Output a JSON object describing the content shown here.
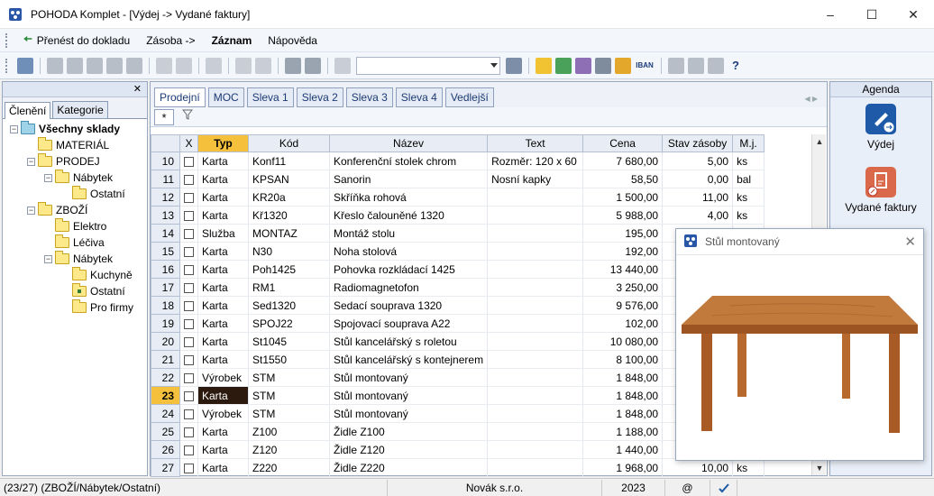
{
  "window": {
    "title": "POHODA Komplet - [Výdej -> Vydané faktury]"
  },
  "menu": [
    {
      "label": "Přenést do dokladu",
      "bold": false
    },
    {
      "label": "Zásoba ->",
      "bold": false
    },
    {
      "label": "Záznam",
      "bold": true
    },
    {
      "label": "Nápověda",
      "bold": false
    }
  ],
  "toolbar": {
    "iban_label": "IBAN",
    "search_value": ""
  },
  "left": {
    "tabs": [
      "Členění",
      "Kategorie"
    ],
    "tree": [
      {
        "label": "Všechny sklady",
        "level": 0,
        "bold": true,
        "expander": "−",
        "icon": "db"
      },
      {
        "label": "MATERIÁL",
        "level": 1,
        "bold": false,
        "expander": "",
        "icon": "folder"
      },
      {
        "label": "PRODEJ",
        "level": 1,
        "bold": false,
        "expander": "−",
        "icon": "folder"
      },
      {
        "label": "Nábytek",
        "level": 2,
        "bold": false,
        "expander": "−",
        "icon": "folder"
      },
      {
        "label": "Ostatní",
        "level": 3,
        "bold": false,
        "expander": "",
        "icon": "folder"
      },
      {
        "label": "ZBOŽÍ",
        "level": 1,
        "bold": false,
        "expander": "−",
        "icon": "folder"
      },
      {
        "label": "Elektro",
        "level": 2,
        "bold": false,
        "expander": "",
        "icon": "folder"
      },
      {
        "label": "Léčiva",
        "level": 2,
        "bold": false,
        "expander": "",
        "icon": "folder"
      },
      {
        "label": "Nábytek",
        "level": 2,
        "bold": false,
        "expander": "−",
        "icon": "folder"
      },
      {
        "label": "Kuchyně",
        "level": 3,
        "bold": false,
        "expander": "",
        "icon": "folder"
      },
      {
        "label": "Ostatní",
        "level": 3,
        "bold": false,
        "expander": "",
        "icon": "mark"
      },
      {
        "label": "Pro firmy",
        "level": 3,
        "bold": false,
        "expander": "",
        "icon": "folder"
      }
    ]
  },
  "tabs": [
    "Prodejní",
    "MOC",
    "Sleva 1",
    "Sleva 2",
    "Sleva 3",
    "Sleva 4",
    "Vedlejší"
  ],
  "filter_star": "*",
  "table": {
    "columns": [
      "",
      "X",
      "Typ",
      "Kód",
      "Název",
      "Text",
      "Cena",
      "Stav zásoby",
      "M.j."
    ],
    "rows": [
      [
        "10",
        "Karta",
        "Konf11",
        "Konferenční stolek chrom",
        "Rozměr: 120 x 60",
        "7 680,00",
        "5,00",
        "ks"
      ],
      [
        "11",
        "Karta",
        "KPSAN",
        "Sanorin",
        "Nosní kapky",
        "58,50",
        "0,00",
        "bal"
      ],
      [
        "12",
        "Karta",
        "KR20a",
        "Skříňka rohová",
        "",
        "1 500,00",
        "11,00",
        "ks"
      ],
      [
        "13",
        "Karta",
        "Kř1320",
        "Křeslo čalouněné 1320",
        "",
        "5 988,00",
        "4,00",
        "ks"
      ],
      [
        "14",
        "Služba",
        "MONTAZ",
        "Montáž stolu",
        "",
        "195,00",
        "",
        ""
      ],
      [
        "15",
        "Karta",
        "N30",
        "Noha stolová",
        "",
        "192,00",
        "",
        ""
      ],
      [
        "16",
        "Karta",
        "Poh1425",
        "Pohovka rozkládací 1425",
        "",
        "13 440,00",
        "",
        ""
      ],
      [
        "17",
        "Karta",
        "RM1",
        "Radiomagnetofon",
        "",
        "3 250,00",
        "",
        ""
      ],
      [
        "18",
        "Karta",
        "Sed1320",
        "Sedací souprava 1320",
        "",
        "9 576,00",
        "",
        ""
      ],
      [
        "19",
        "Karta",
        "SPOJ22",
        "Spojovací souprava A22",
        "",
        "102,00",
        "",
        ""
      ],
      [
        "20",
        "Karta",
        "St1045",
        "Stůl kancelářský s roletou",
        "",
        "10 080,00",
        "",
        ""
      ],
      [
        "21",
        "Karta",
        "St1550",
        "Stůl kancelářský s kontejnerem",
        "",
        "8 100,00",
        "",
        ""
      ],
      [
        "22",
        "Výrobek",
        "STM",
        "Stůl montovaný",
        "",
        "1 848,00",
        "",
        ""
      ],
      [
        "23",
        "Karta",
        "STM",
        "Stůl montovaný",
        "",
        "1 848,00",
        "",
        ""
      ],
      [
        "24",
        "Výrobek",
        "STM",
        "Stůl montovaný",
        "",
        "1 848,00",
        "",
        ""
      ],
      [
        "25",
        "Karta",
        "Z100",
        "Židle Z100",
        "",
        "1 188,00",
        "",
        ""
      ],
      [
        "26",
        "Karta",
        "Z120",
        "Židle Z120",
        "",
        "1 440,00",
        "",
        ""
      ],
      [
        "27",
        "Karta",
        "Z220",
        "Židle Z220",
        "",
        "1 968,00",
        "10,00",
        "ks"
      ]
    ],
    "current_row": "23"
  },
  "agenda": {
    "title": "Agenda",
    "items": [
      {
        "label": "Výdej",
        "color": "#1e5aa8"
      },
      {
        "label": "Vydané faktury",
        "color": "#d9694a"
      }
    ]
  },
  "popup": {
    "title": "Stůl montovaný",
    "wood_color": "#b5652a"
  },
  "status": {
    "record": "(23/27) (ZBOŽÍ/Nábytek/Ostatní)",
    "company": "Novák  s.r.o.",
    "year": "2023",
    "at": "@"
  }
}
